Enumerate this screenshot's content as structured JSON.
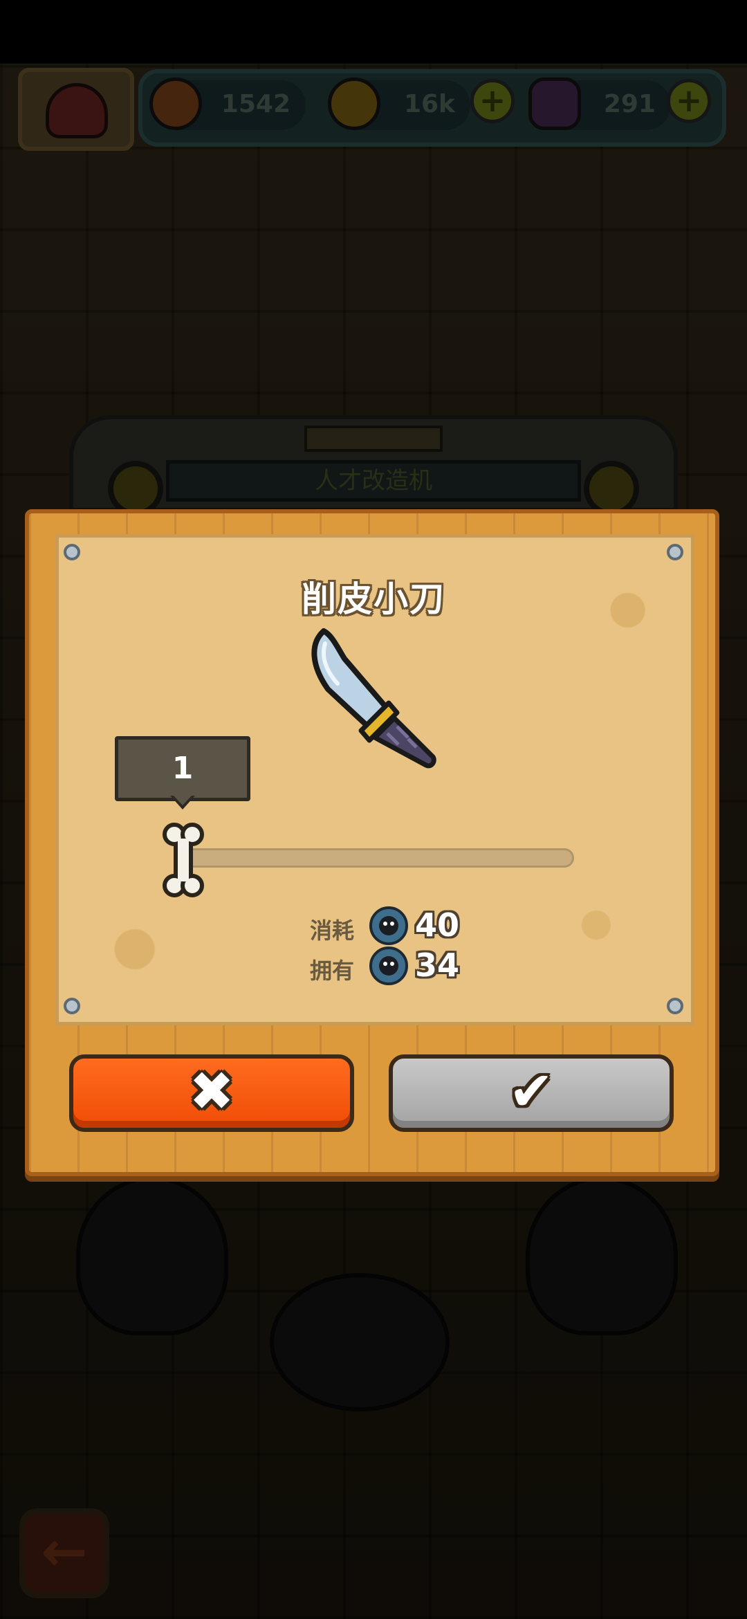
{
  "resources": {
    "gems": "1542",
    "coins": "16k",
    "potions": "291"
  },
  "background": {
    "machine_title": "人才改造机"
  },
  "dialog": {
    "item_name": "削皮小刀",
    "quantity": "1",
    "slider_fraction": 0,
    "cost": {
      "label": "消耗",
      "value": "40"
    },
    "owned": {
      "label": "拥有",
      "value": "34"
    },
    "cancel_glyph": "✖",
    "confirm_glyph": "✔"
  },
  "colors": {
    "cancel_button": "#f25a0e",
    "confirm_button": "#b5b5b5",
    "board": "#dc9a3d",
    "paper": "#e8c383"
  },
  "icons": {
    "item": "knife-icon",
    "currency": "blue-fuzzball-token-icon",
    "back": "arrow-left-icon"
  }
}
